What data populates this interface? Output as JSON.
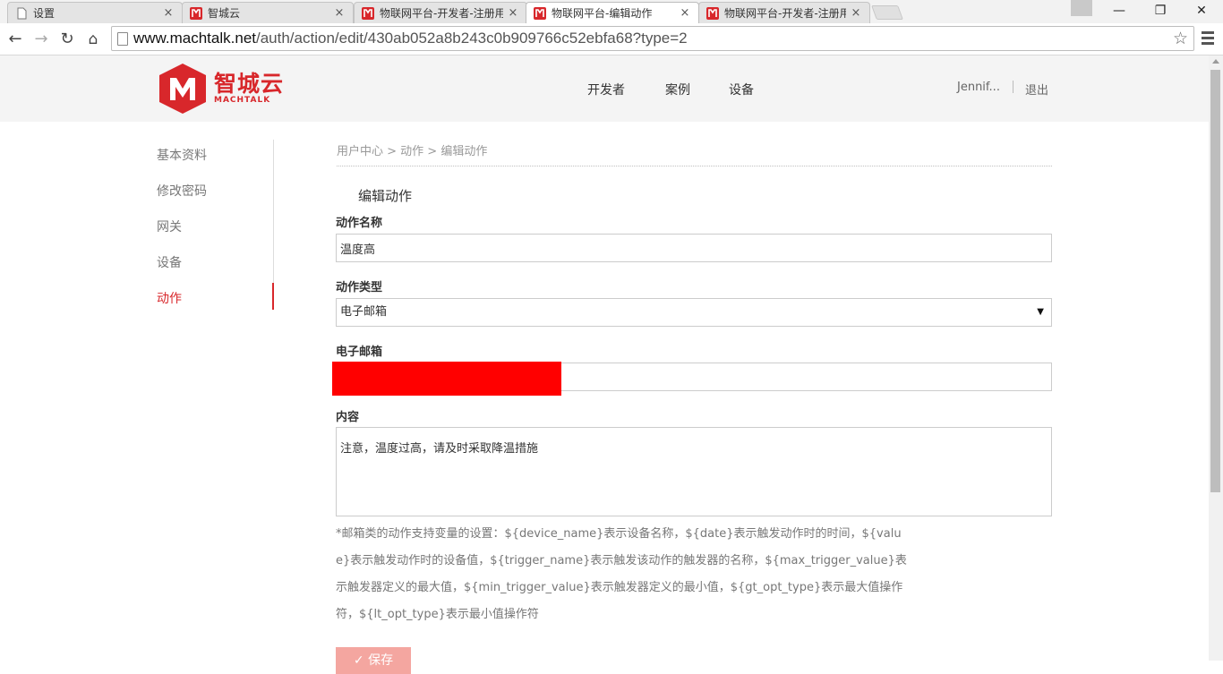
{
  "browser": {
    "tabs": [
      {
        "title": "设置",
        "icon": "page-icon"
      },
      {
        "title": "智城云",
        "icon": "machtalk-favicon"
      },
      {
        "title": "物联网平台-开发者-注册用",
        "icon": "machtalk-favicon"
      },
      {
        "title": "物联网平台-编辑动作",
        "icon": "machtalk-favicon",
        "active": true
      },
      {
        "title": "物联网平台-开发者-注册用",
        "icon": "machtalk-favicon"
      }
    ],
    "close_glyph": "×",
    "url_host": "www.machtalk.net",
    "url_path": "/auth/action/edit/430ab052a8b243c0b909766c52ebfa68?type=2",
    "window_controls": {
      "minimize": "—",
      "restore": "❐",
      "close": "✕"
    }
  },
  "header": {
    "logo_cn": "智城云",
    "logo_en": "MACHTALK",
    "nav": [
      "开发者",
      "案例",
      "设备"
    ],
    "username": "Jennif...",
    "logout": "退出",
    "brand_color": "#d8272b"
  },
  "sidebar": {
    "items": [
      "基本资料",
      "修改密码",
      "网关",
      "设备",
      "动作"
    ],
    "active_index": 4
  },
  "main": {
    "breadcrumb": "用户中心 > 动作 > 编辑动作",
    "section_title": "编辑动作",
    "fields": {
      "name_label": "动作名称",
      "name_value": "温度高",
      "type_label": "动作类型",
      "type_value": "电子邮箱",
      "email_label": "电子邮箱",
      "content_label": "内容",
      "content_value": "注意，温度过高，请及时采取降温措施"
    },
    "hint": "*邮箱类的动作支持变量的设置：${device_name}表示设备名称，${date}表示触发动作时的时间，${value}表示触发动作时的设备值，${trigger_name}表示触发该动作的触发器的名称，${max_trigger_value}表示触发器定义的最大值，${min_trigger_value}表示触发器定义的最小值，${gt_opt_type}表示最大值操作符，${lt_opt_type}表示最小值操作符",
    "save_label": "✓ 保存"
  }
}
